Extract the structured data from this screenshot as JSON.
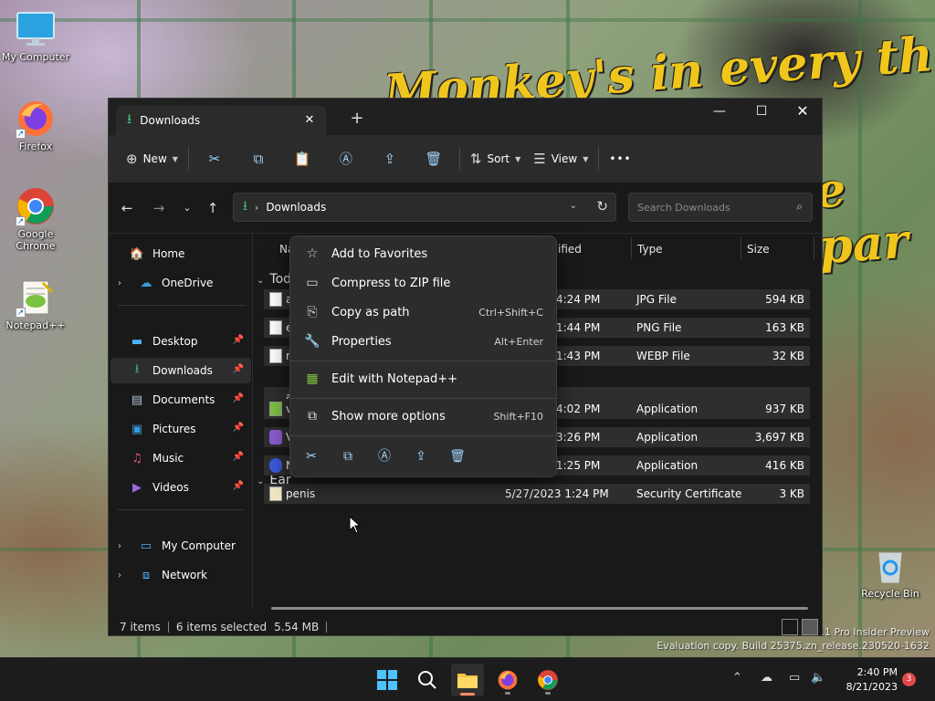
{
  "desktop": {
    "wallpaper_text_1": "Monkey's in every th",
    "wallpaper_text_2": "e par",
    "icons": [
      {
        "label": "My Computer"
      },
      {
        "label": "Firefox"
      },
      {
        "label": "Google Chrome"
      },
      {
        "label": "Notepad++"
      },
      {
        "label": "Recycle Bin"
      }
    ],
    "watermark": {
      "line1": "11 Pro Insider Preview",
      "line2": "Evaluation copy. Build 25375.zn_release.230520-1632"
    }
  },
  "explorer": {
    "tab_title": "Downloads",
    "tab_close": "✕",
    "new_tab": "+",
    "window_controls": {
      "minimize": "—",
      "maximize": "☐",
      "close": "✕"
    },
    "toolbar": {
      "new_label": "New",
      "sort_label": "Sort",
      "view_label": "View",
      "more_label": "•••"
    },
    "address": {
      "crumb": "Downloads",
      "separator": "›"
    },
    "search": {
      "placeholder": "Search Downloads"
    },
    "nav": {
      "items": [
        {
          "label": "Home"
        },
        {
          "label": "OneDrive"
        },
        {
          "label": "Desktop"
        },
        {
          "label": "Downloads"
        },
        {
          "label": "Documents"
        },
        {
          "label": "Pictures"
        },
        {
          "label": "Music"
        },
        {
          "label": "Videos"
        },
        {
          "label": "My Computer"
        },
        {
          "label": "Network"
        }
      ]
    },
    "columns": {
      "name": "Na",
      "date": "ified",
      "type": "Type",
      "size": "Size"
    },
    "groups": {
      "today": "Tod",
      "earlier": "Ear"
    },
    "files": [
      {
        "name": "a",
        "date": "4:24 PM",
        "type": "JPG File",
        "size": "594 KB"
      },
      {
        "name": "e",
        "date": "1:44 PM",
        "type": "PNG File",
        "size": "163 KB"
      },
      {
        "name": "r",
        "date": "1:43 PM",
        "type": "WEBP File",
        "size": "32 KB"
      },
      {
        "name": "v",
        "date": "4:02 PM",
        "type": "Application",
        "size": "937 KB"
      },
      {
        "name": "V",
        "date": "3:26 PM",
        "type": "Application",
        "size": "3,697 KB"
      },
      {
        "name": "N",
        "date": "1:25 PM",
        "type": "Application",
        "size": "416 KB"
      },
      {
        "name": "penis",
        "date": "5/27/2023 1:24 PM",
        "type": "Security Certificate",
        "size": "3 KB"
      }
    ],
    "status": {
      "items": "7 items",
      "selected": "6 items selected",
      "size": "5.54 MB"
    }
  },
  "context_menu": {
    "items": [
      {
        "label": "Add to Favorites",
        "shortcut": ""
      },
      {
        "label": "Compress to ZIP file",
        "shortcut": ""
      },
      {
        "label": "Copy as path",
        "shortcut": "Ctrl+Shift+C"
      },
      {
        "label": "Properties",
        "shortcut": "Alt+Enter"
      },
      {
        "label": "Edit with Notepad++",
        "shortcut": ""
      },
      {
        "label": "Show more options",
        "shortcut": "Shift+F10"
      }
    ]
  },
  "taskbar": {
    "time": "2:40 PM",
    "date": "8/21/2023",
    "notification_count": "3"
  },
  "colors": {
    "accent": "#60cdff",
    "download_green": "#3ec070",
    "folder_yellow": "#f4c542"
  }
}
